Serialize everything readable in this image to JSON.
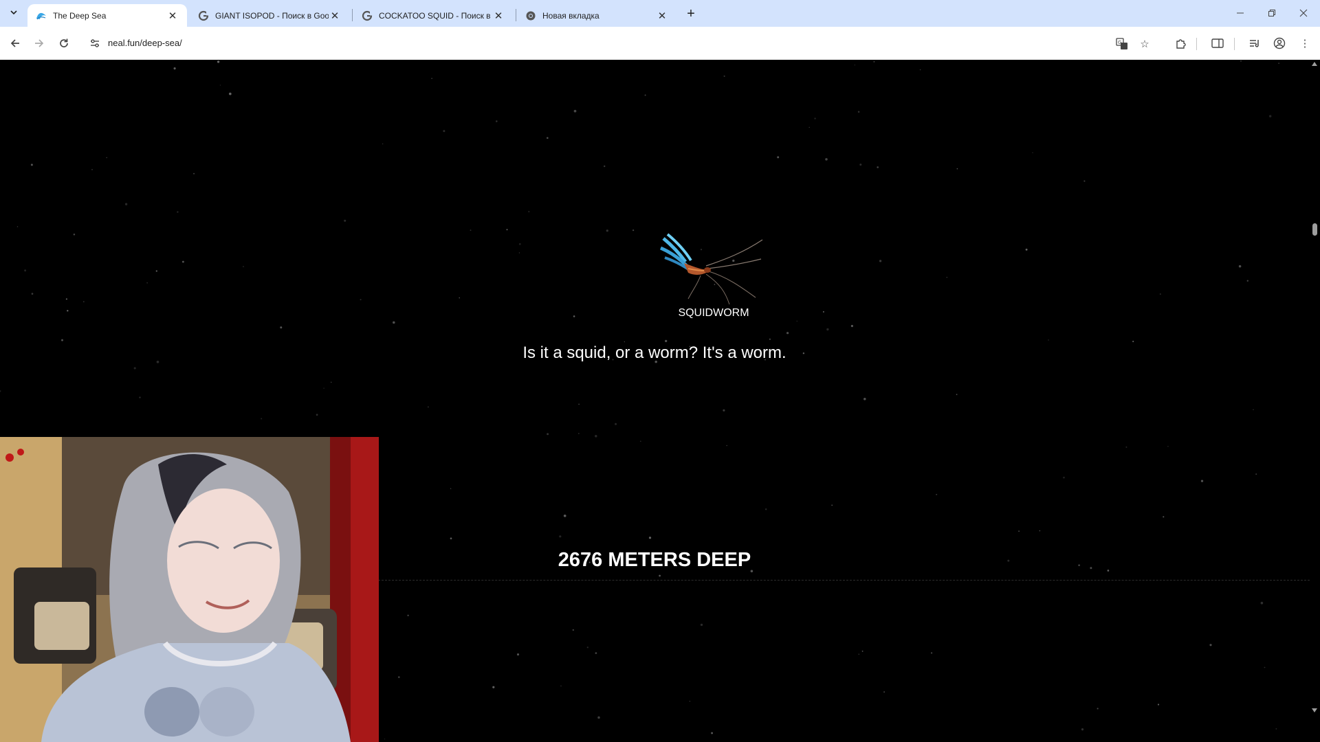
{
  "browser": {
    "tabs": [
      {
        "title": "The Deep Sea",
        "active": true,
        "favicon": "wave-icon"
      },
      {
        "title": "GIANT ISOPOD - Поиск в Google",
        "active": false,
        "favicon": "google-icon"
      },
      {
        "title": "COCKATOO SQUID - Поиск в Google",
        "active": false,
        "favicon": "google-icon"
      },
      {
        "title": "Новая вкладка",
        "active": false,
        "favicon": "chrome-icon"
      }
    ],
    "url": "neal.fun/deep-sea/",
    "accent_color": "#d3e3fd"
  },
  "page": {
    "creature": {
      "name": "SQUIDWORM",
      "icon": "squidworm-illustration"
    },
    "description": "Is it a squid, or a worm? It's a worm.",
    "depth_label": "2676 METERS DEEP",
    "background_color": "#000000"
  },
  "overlay": {
    "type": "webcam",
    "icon": "streamer-webcam-feed"
  }
}
